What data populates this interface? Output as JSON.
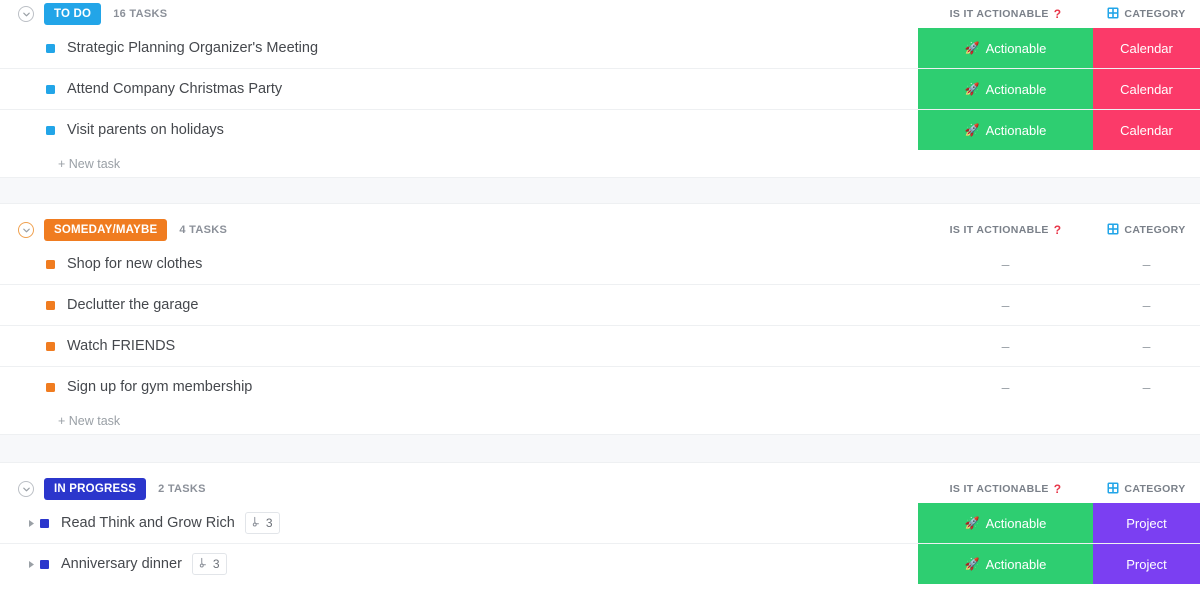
{
  "columns": {
    "actionable_label": "IS IT ACTIONABLE",
    "actionable_marker": "?",
    "category_label": "CATEGORY",
    "category_icon": "grid-icon",
    "empty_value": "–"
  },
  "labels": {
    "new_task": "+ New task",
    "rocket_icon": "🚀"
  },
  "colors": {
    "todo_badge": "#22a5e8",
    "someday_badge": "#f07c20",
    "inprogress_badge": "#2b36cc",
    "actionable_cell": "#2ece71",
    "calendar_cell": "#fb3a69",
    "project_cell": "#7b3ff2",
    "question_mark": "#e8374a",
    "category_icon": "#22a5e8"
  },
  "groups": [
    {
      "id": "todo",
      "status": "TO DO",
      "task_count": "16 TASKS",
      "badge_color": "#22a5e8",
      "bullet_class": "blue",
      "chevron_class": "",
      "tasks": [
        {
          "name": "Strategic Planning Organizer's Meeting",
          "actionable": "Actionable",
          "category": "Calendar",
          "actionable_color": "#2ece71",
          "category_color": "#fb3a69",
          "has_expand": false,
          "subtasks": null
        },
        {
          "name": "Attend Company Christmas Party",
          "actionable": "Actionable",
          "category": "Calendar",
          "actionable_color": "#2ece71",
          "category_color": "#fb3a69",
          "has_expand": false,
          "subtasks": null
        },
        {
          "name": "Visit parents on holidays",
          "actionable": "Actionable",
          "category": "Calendar",
          "actionable_color": "#2ece71",
          "category_color": "#fb3a69",
          "has_expand": false,
          "subtasks": null
        }
      ]
    },
    {
      "id": "someday",
      "status": "SOMEDAY/MAYBE",
      "task_count": "4 TASKS",
      "badge_color": "#f07c20",
      "bullet_class": "orange",
      "chevron_class": "orange",
      "tasks": [
        {
          "name": "Shop for new clothes",
          "actionable": "–",
          "category": "–",
          "actionable_color": "",
          "category_color": "",
          "has_expand": false,
          "subtasks": null
        },
        {
          "name": "Declutter the garage",
          "actionable": "–",
          "category": "–",
          "actionable_color": "",
          "category_color": "",
          "has_expand": false,
          "subtasks": null
        },
        {
          "name": "Watch FRIENDS",
          "actionable": "–",
          "category": "–",
          "actionable_color": "",
          "category_color": "",
          "has_expand": false,
          "subtasks": null
        },
        {
          "name": "Sign up for gym membership",
          "actionable": "–",
          "category": "–",
          "actionable_color": "",
          "category_color": "",
          "has_expand": false,
          "subtasks": null
        }
      ]
    },
    {
      "id": "inprogress",
      "status": "IN PROGRESS",
      "task_count": "2 TASKS",
      "badge_color": "#2b36cc",
      "bullet_class": "navy",
      "chevron_class": "",
      "tasks": [
        {
          "name": "Read Think and Grow Rich",
          "actionable": "Actionable",
          "category": "Project",
          "actionable_color": "#2ece71",
          "category_color": "#7b3ff2",
          "has_expand": true,
          "subtasks": "3"
        },
        {
          "name": "Anniversary dinner",
          "actionable": "Actionable",
          "category": "Project",
          "actionable_color": "#2ece71",
          "category_color": "#7b3ff2",
          "has_expand": true,
          "subtasks": "3"
        }
      ]
    }
  ]
}
